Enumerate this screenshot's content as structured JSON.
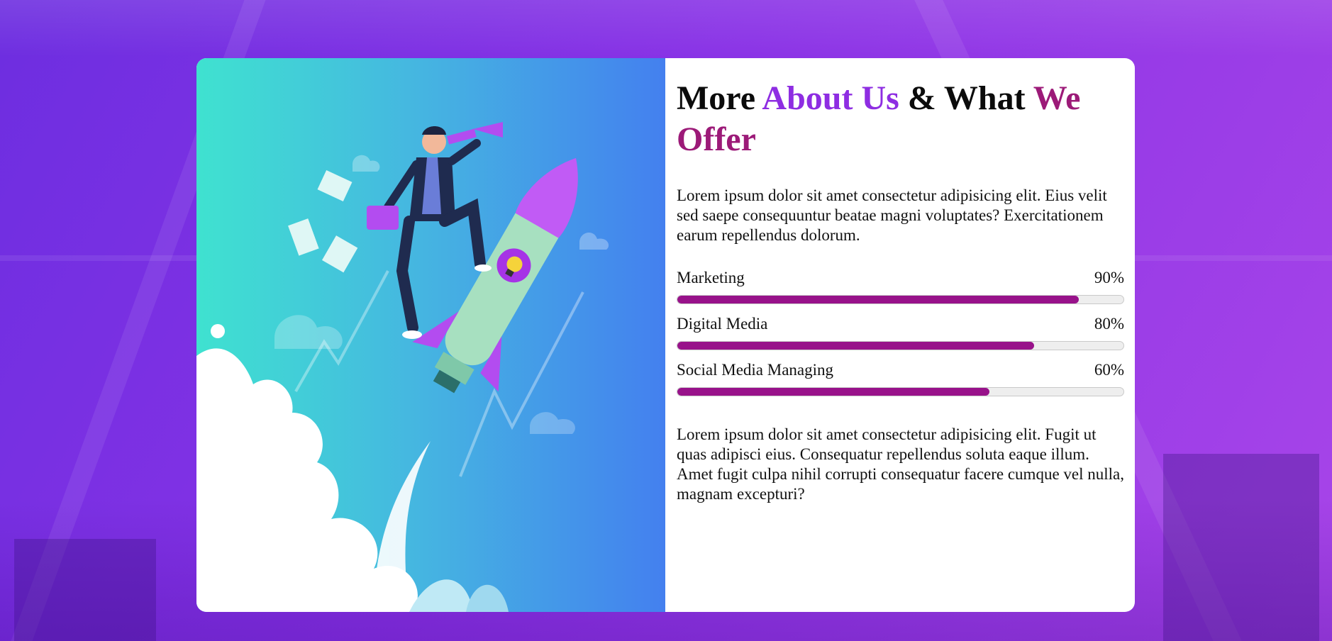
{
  "colors": {
    "accent_purple": "#8e2de2",
    "accent_magenta": "#9c1a78",
    "bar_fill": "#98128a",
    "bar_track": "#eeeeee"
  },
  "section": {
    "title_parts": [
      "More ",
      "About Us",
      " & What ",
      "We Offer"
    ],
    "intro": "Lorem ipsum dolor sit amet consectetur adipisicing elit. Eius velit sed saepe consequuntur beatae magni voluptates? Exercitationem earum repellendus dolorum.",
    "skills": [
      {
        "label": "Marketing",
        "percent_text": "90%",
        "fill_fraction": 0.9
      },
      {
        "label": "Digital Media",
        "percent_text": "80%",
        "fill_fraction": 0.8
      },
      {
        "label": "Social Media Managing",
        "percent_text": "60%",
        "fill_fraction": 0.7
      }
    ],
    "outro": "Lorem ipsum dolor sit amet consectetur adipisicing elit. Fugit ut quas adipisci eius. Consequatur repellendus soluta eaque illum. Amet fugit culpa nihil corrupti consequatur facere cumque vel nulla, magnam excepturi?"
  },
  "illustration": {
    "icon": "rocket-businessman-illustration"
  }
}
